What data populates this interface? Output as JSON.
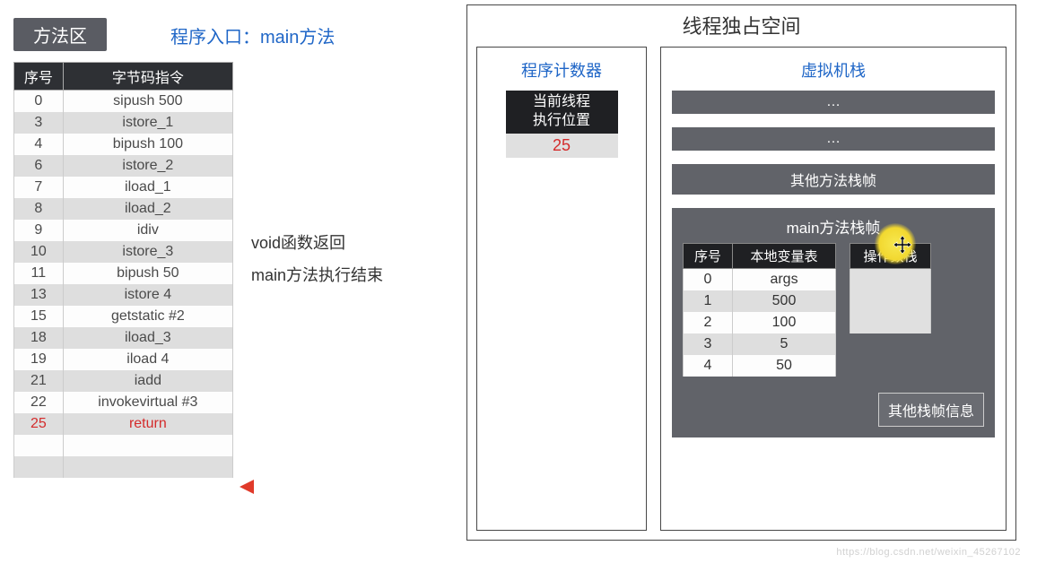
{
  "left": {
    "method_area_label": "方法区",
    "entry_label": "程序入口：main方法",
    "headers": {
      "idx": "序号",
      "inst": "字节码指令"
    },
    "rows": [
      {
        "idx": "0",
        "inst": "sipush 500"
      },
      {
        "idx": "3",
        "inst": "istore_1"
      },
      {
        "idx": "4",
        "inst": "bipush 100"
      },
      {
        "idx": "6",
        "inst": "istore_2"
      },
      {
        "idx": "7",
        "inst": "iload_1"
      },
      {
        "idx": "8",
        "inst": "iload_2"
      },
      {
        "idx": "9",
        "inst": "idiv"
      },
      {
        "idx": "10",
        "inst": "istore_3"
      },
      {
        "idx": "11",
        "inst": "bipush 50"
      },
      {
        "idx": "13",
        "inst": "istore 4"
      },
      {
        "idx": "15",
        "inst": "getstatic #2"
      },
      {
        "idx": "18",
        "inst": "iload_3"
      },
      {
        "idx": "19",
        "inst": "iload 4"
      },
      {
        "idx": "21",
        "inst": "iadd"
      },
      {
        "idx": "22",
        "inst": "invokevirtual #3"
      },
      {
        "idx": "25",
        "inst": "return",
        "hl": true
      },
      {
        "idx": "",
        "inst": ""
      },
      {
        "idx": "",
        "inst": ""
      }
    ]
  },
  "note": {
    "line1": "void函数返回",
    "line2": "main方法执行结束"
  },
  "thread": {
    "title": "线程独占空间",
    "pc_title": "程序计数器",
    "pc_header_l1": "当前线程",
    "pc_header_l2": "执行位置",
    "pc_value": "25",
    "vm_title": "虚拟机栈",
    "bar_dots": "…",
    "bar_other": "其他方法栈帧",
    "main_frame_title": "main方法栈帧",
    "lv_headers": {
      "idx": "序号",
      "name": "本地变量表"
    },
    "lv_rows": [
      {
        "idx": "0",
        "val": "args"
      },
      {
        "idx": "1",
        "val": "500"
      },
      {
        "idx": "2",
        "val": "100"
      },
      {
        "idx": "3",
        "val": "5"
      },
      {
        "idx": "4",
        "val": "50"
      }
    ],
    "op_header": "操作数栈",
    "op_rows": 3,
    "other_info": "其他栈帧信息"
  },
  "watermark": "https://blog.csdn.net/weixin_45267102"
}
